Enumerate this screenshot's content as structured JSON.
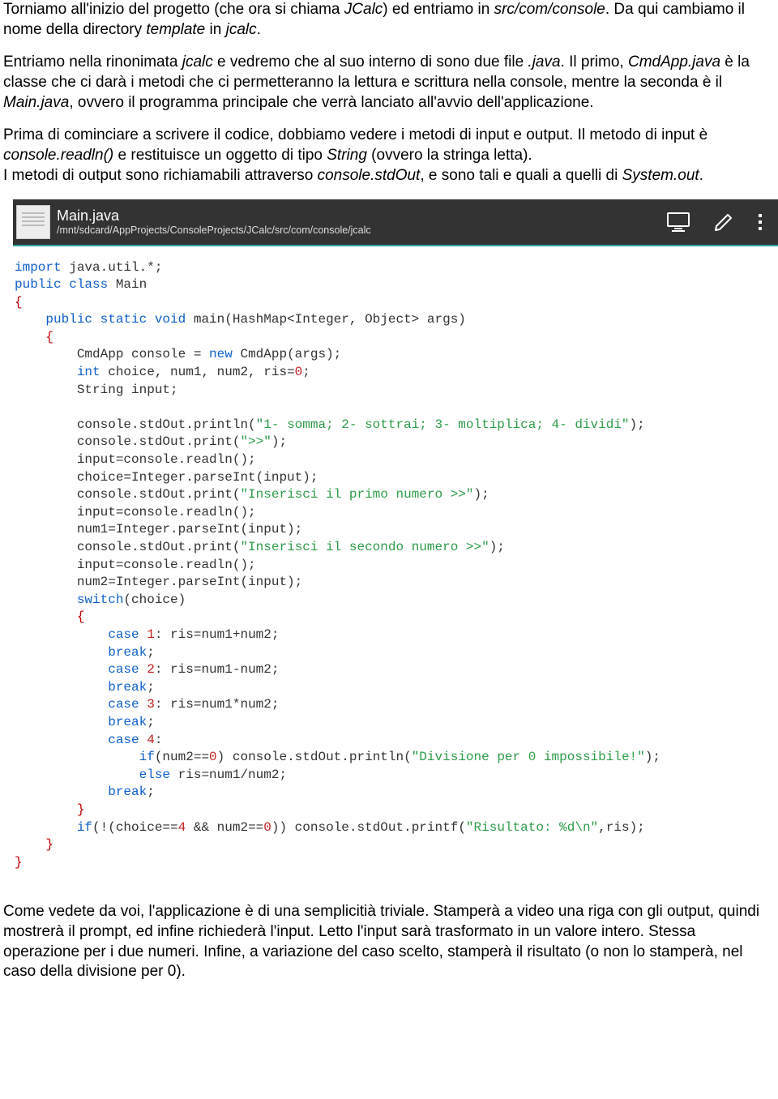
{
  "para1_a": "Torniamo all'inizio del progetto (che ora si chiama ",
  "para1_jcalc": "JCalc",
  "para1_b": ") ed entriamo in ",
  "para1_path": "src/com/console",
  "para1_c": ". Da qui cambiamo il nome della directory ",
  "para1_tpl": "template",
  "para1_d": " in ",
  "para1_jcalc2": "jcalc",
  "para1_e": ".",
  "para2_a": "Entriamo nella rinonimata ",
  "para2_jcalc": "jcalc",
  "para2_b": " e vedremo che al suo interno di sono due file ",
  "para2_java": ".java",
  "para2_c": ". Il primo, ",
  "para2_cmd": "CmdApp.java",
  "para2_d": " è la classe che ci darà i metodi che ci permetteranno la lettura e scrittura nella console, mentre la seconda è il ",
  "para2_main": "Main.java",
  "para2_e": ", ovvero il programma principale che verrà lanciato all'avvio dell'applicazione.",
  "para3_a": "Prima di cominciare a scrivere il codice, dobbiamo vedere i metodi di input e output. Il metodo di input è ",
  "para3_readln": "console.readln()",
  "para3_b": " e restituisce un oggetto di tipo ",
  "para3_str": "String",
  "para3_c": " (ovvero la stringa letta).",
  "para3_d": "I metodi di output sono richiamabili attraverso ",
  "para3_stdout": "console.stdOut",
  "para3_e": ", e sono tali e quali a quelli di ",
  "para3_sys": "System.out",
  "para3_f": ".",
  "ide": {
    "filename": "Main.java",
    "filepath": "/mnt/sdcard/AppProjects/ConsoleProjects/JCalc/src/com/console/jcalc"
  },
  "code": {
    "l1a": "import",
    "l1b": " java.util.*;",
    "l2a": "public class",
    "l2b": " Main",
    "l3": "{",
    "l4a": "    ",
    "l4b": "public static void",
    "l4c": " main(HashMap<Integer, Object> args)",
    "l5a": "    ",
    "l5b": "{",
    "l6a": "        CmdApp console = ",
    "l6b": "new",
    "l6c": " CmdApp(args);",
    "l7a": "        ",
    "l7b": "int",
    "l7c": " choice, num1, num2, ris=",
    "l7d": "0",
    "l7e": ";",
    "l8": "        String input;",
    "l9": "",
    "l10a": "        console.stdOut.println(",
    "l10b": "\"1- somma; 2- sottrai; 3- moltiplica; 4- dividi\"",
    "l10c": ");",
    "l11a": "        console.stdOut.print(",
    "l11b": "\">>\"",
    "l11c": ");",
    "l12": "        input=console.readln();",
    "l13": "        choice=Integer.parseInt(input);",
    "l14a": "        console.stdOut.print(",
    "l14b": "\"Inserisci il primo numero >>\"",
    "l14c": ");",
    "l15": "        input=console.readln();",
    "l16": "        num1=Integer.parseInt(input);",
    "l17a": "        console.stdOut.print(",
    "l17b": "\"Inserisci il secondo numero >>\"",
    "l17c": ");",
    "l18": "        input=console.readln();",
    "l19": "        num2=Integer.parseInt(input);",
    "l20a": "        ",
    "l20b": "switch",
    "l20c": "(choice)",
    "l21a": "        ",
    "l21b": "{",
    "l22a": "            ",
    "l22b": "case",
    "l22c": " ",
    "l22d": "1",
    "l22e": ": ris=num1+num2;",
    "l23a": "            ",
    "l23b": "break",
    "l23c": ";",
    "l24a": "            ",
    "l24b": "case",
    "l24c": " ",
    "l24d": "2",
    "l24e": ": ris=num1-num2;",
    "l25a": "            ",
    "l25b": "break",
    "l25c": ";",
    "l26a": "            ",
    "l26b": "case",
    "l26c": " ",
    "l26d": "3",
    "l26e": ": ris=num1*num2;",
    "l27a": "            ",
    "l27b": "break",
    "l27c": ";",
    "l28a": "            ",
    "l28b": "case",
    "l28c": " ",
    "l28d": "4",
    "l28e": ":",
    "l29a": "                ",
    "l29b": "if",
    "l29c": "(num2==",
    "l29d": "0",
    "l29e": ") console.stdOut.println(",
    "l29f": "\"Divisione per 0 impossibile!\"",
    "l29g": ");",
    "l30a": "                ",
    "l30b": "else",
    "l30c": " ris=num1/num2;",
    "l31a": "            ",
    "l31b": "break",
    "l31c": ";",
    "l32a": "        ",
    "l32b": "}",
    "l33a": "        ",
    "l33b": "if",
    "l33c": "(!(choice==",
    "l33d": "4",
    "l33e": " && num2==",
    "l33f": "0",
    "l33g": ")) console.stdOut.printf(",
    "l33h": "\"Risultato: %d\\n\"",
    "l33i": ",ris);",
    "l34a": "    ",
    "l34b": "}",
    "l35": "}"
  },
  "para4": "Come vedete da voi, l'applicazione è di una semplicitià triviale. Stamperà a video una riga con gli output, quindi mostrerà il prompt, ed infine richiederà l'input. Letto l'input sarà trasformato in un valore intero. Stessa operazione per i due numeri. Infine, a variazione del caso scelto, stamperà il risultato (o non lo stamperà, nel caso della divisione per 0)."
}
